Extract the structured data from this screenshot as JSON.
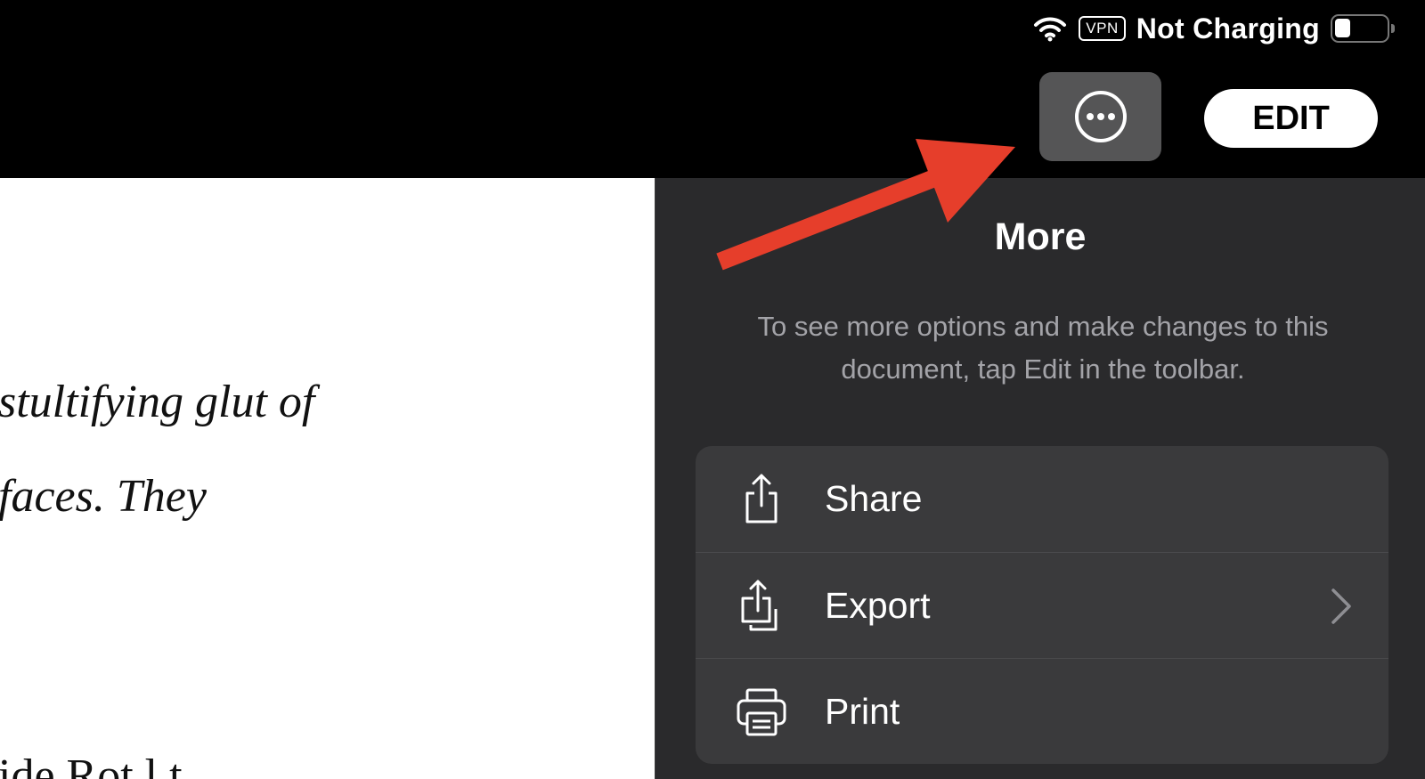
{
  "status_bar": {
    "wifi_icon": "wifi-icon",
    "vpn_label": "VPN",
    "charging_text": "Not Charging",
    "battery_level": 0.3
  },
  "toolbar": {
    "more_icon": "ellipsis-circle-icon",
    "edit_label": "EDIT"
  },
  "document": {
    "lines": [
      "stultifying glut of",
      "faces. They",
      "ide  Rot  l  t"
    ]
  },
  "more_panel": {
    "title": "More",
    "description": "To see more options and make changes to this document, tap Edit in the toolbar.",
    "items": [
      {
        "label": "Share",
        "icon": "share-icon",
        "has_chevron": false
      },
      {
        "label": "Export",
        "icon": "export-icon",
        "has_chevron": true
      },
      {
        "label": "Print",
        "icon": "printer-icon",
        "has_chevron": false
      }
    ]
  },
  "colors": {
    "panel_bg": "#2a2a2c",
    "menu_bg": "#3a3a3c",
    "more_button_bg": "#555556",
    "annotation_arrow": "#e63e2b"
  }
}
